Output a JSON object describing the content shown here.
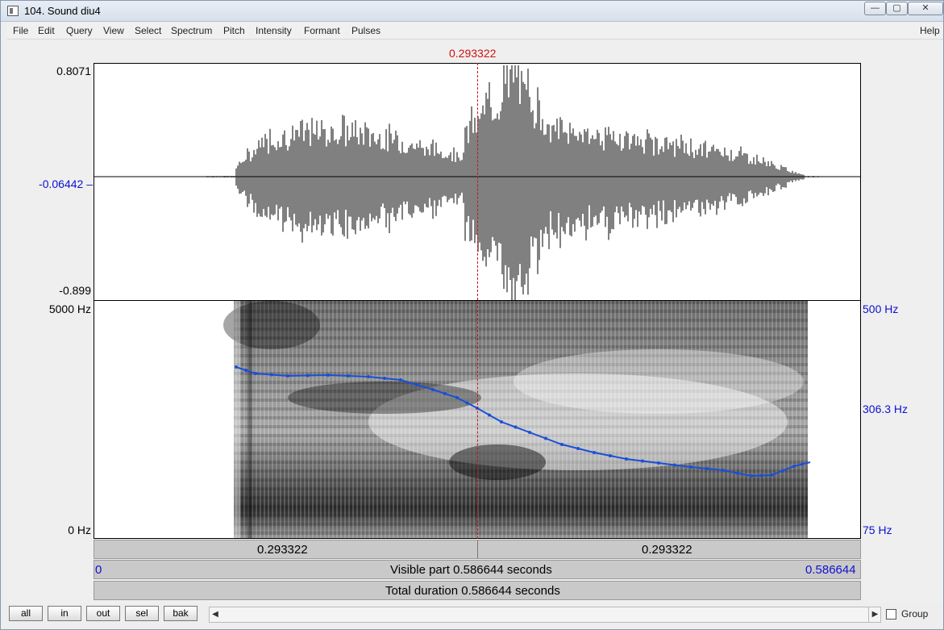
{
  "window": {
    "title": "104. Sound diu4",
    "minimize": "—",
    "maximize": "▢",
    "close": "✕"
  },
  "menu": {
    "items": [
      "File",
      "Edit",
      "Query",
      "View",
      "Select",
      "Spectrum",
      "Pitch",
      "Intensity",
      "Formant",
      "Pulses"
    ],
    "help": "Help"
  },
  "cursor": {
    "time_label": "0.293322"
  },
  "waveform": {
    "max_label": "0.8071",
    "cursor_value_label": "-0.06442",
    "min_label": "-0.899"
  },
  "spectrogram": {
    "top_freq_label": "5000 Hz",
    "bottom_freq_label": "0 Hz"
  },
  "pitch": {
    "top_label": "500 Hz",
    "cursor_label": "306.3 Hz",
    "bottom_label": "75 Hz",
    "color": "#1a4fd8"
  },
  "time_bars": {
    "left_segment": "0.293322",
    "right_segment": "0.293322",
    "visible_start": "0",
    "visible_text": "Visible part 0.586644 seconds",
    "visible_end": "0.586644",
    "total_text": "Total duration 0.586644 seconds"
  },
  "bottom": {
    "buttons": [
      "all",
      "in",
      "out",
      "sel",
      "bak"
    ],
    "scroll_left": "◀",
    "scroll_right": "▶",
    "group_label": "Group"
  }
}
